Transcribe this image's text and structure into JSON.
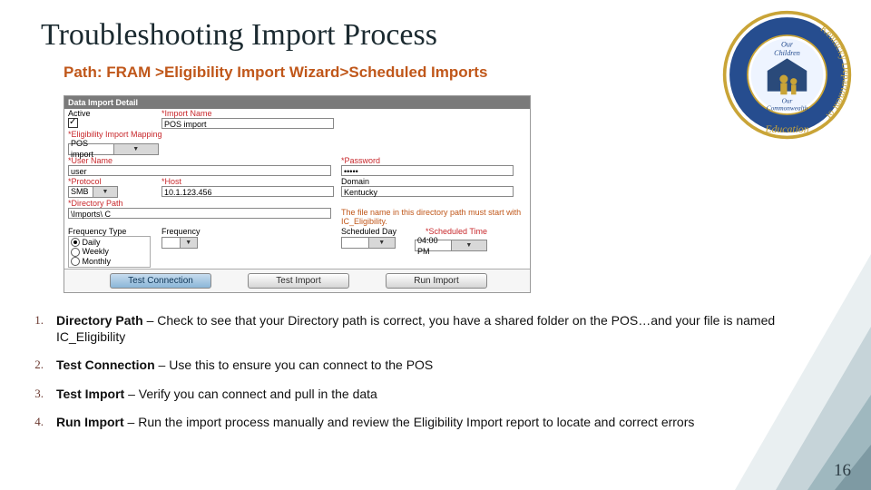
{
  "title": "Troubleshooting Import Process",
  "path": "Path:  FRAM >Eligibility Import Wizard>Scheduled Imports",
  "page_number": "16",
  "seal": {
    "outer_ring": "Kentucky Department of Education",
    "inner1": "Our",
    "inner2": "Children",
    "inner3": "Our",
    "inner4": "Commonwealth"
  },
  "import": {
    "header": "Data Import Detail",
    "labels": {
      "active": "Active",
      "import_name": "*Import Name",
      "elig_map": "*Eligibility Import Mapping",
      "user_name": "*User Name",
      "password": "*Password",
      "protocol": "*Protocol",
      "host": "*Host",
      "domain": "Domain",
      "dir_path": "*Directory Path",
      "freq_type": "Frequency Type",
      "frequency": "Frequency",
      "sched_day": "Scheduled Day",
      "sched_time": "*Scheduled Time"
    },
    "values": {
      "import_name": "POS import",
      "elig_map": "POS import",
      "user_name": "user",
      "password": "•••••",
      "protocol": "SMB",
      "host": "10.1.123.456",
      "domain": "Kentucky",
      "dir_path": "\\Imports\\ C",
      "sched_time": "04:00 PM"
    },
    "freq": {
      "daily": "Daily",
      "weekly": "Weekly",
      "monthly": "Monthly"
    },
    "note": "The file name in this directory path must start with IC_Eligibility.",
    "buttons": {
      "test_conn": "Test Connection",
      "test_import": "Test Import",
      "run_import": "Run Import"
    }
  },
  "steps": [
    {
      "n": "1.",
      "title": "Directory Path",
      "body": " – Check to see that your Directory path is correct, you have a shared folder on the POS…and your file is named IC_Eligibility"
    },
    {
      "n": "2.",
      "title": "Test Connection",
      "body": " – Use this to ensure you can connect to the POS"
    },
    {
      "n": "3.",
      "title": "Test Import",
      "body": " – Verify you can connect and pull in the data"
    },
    {
      "n": "4.",
      "title": "Run Import",
      "body": " – Run the import process manually and review the Eligibility Import report to locate and correct errors"
    }
  ]
}
